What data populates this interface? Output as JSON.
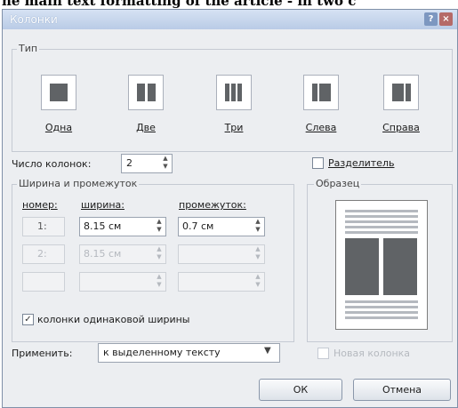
{
  "top_strip_text": "he main text formatting of the article - in two c",
  "dialog": {
    "title": "Колонки",
    "help_icon": "?",
    "close_icon": "×"
  },
  "type_group": {
    "label": "Тип",
    "presets": [
      {
        "label": "Одна",
        "icon": "one-column-icon"
      },
      {
        "label": "Две",
        "icon": "two-columns-icon"
      },
      {
        "label": "Три",
        "icon": "three-columns-icon"
      },
      {
        "label": "Слева",
        "icon": "left-column-icon"
      },
      {
        "label": "Справа",
        "icon": "right-column-icon"
      }
    ]
  },
  "columns_count": {
    "label": "Число колонок:",
    "value": "2"
  },
  "separator": {
    "label": "Разделитель",
    "checked": false
  },
  "width_group": {
    "label": "Ширина и промежуток",
    "headers": {
      "number": "номер:",
      "width": "ширина:",
      "spacing": "промежуток:"
    },
    "rows": [
      {
        "number": "1:",
        "width": "8.15 см",
        "spacing": "0.7 см",
        "enabled": true
      },
      {
        "number": "2:",
        "width": "8.15 см",
        "spacing": "",
        "enabled": false
      },
      {
        "number": "",
        "width": "",
        "spacing": "",
        "enabled": false
      }
    ],
    "equal_width": {
      "label": "колонки одинаковой ширины",
      "checked": true
    }
  },
  "preview_group": {
    "label": "Образец"
  },
  "apply": {
    "label": "Применить:",
    "value": "к выделенному тексту"
  },
  "new_column": {
    "label": "Новая колонка",
    "checked": false
  },
  "buttons": {
    "ok": "ОК",
    "cancel": "Отмена"
  },
  "colors": {
    "title_bar": "#c3d3ec",
    "dialog_bg": "#eceef1",
    "preset_fill": "#606366"
  }
}
